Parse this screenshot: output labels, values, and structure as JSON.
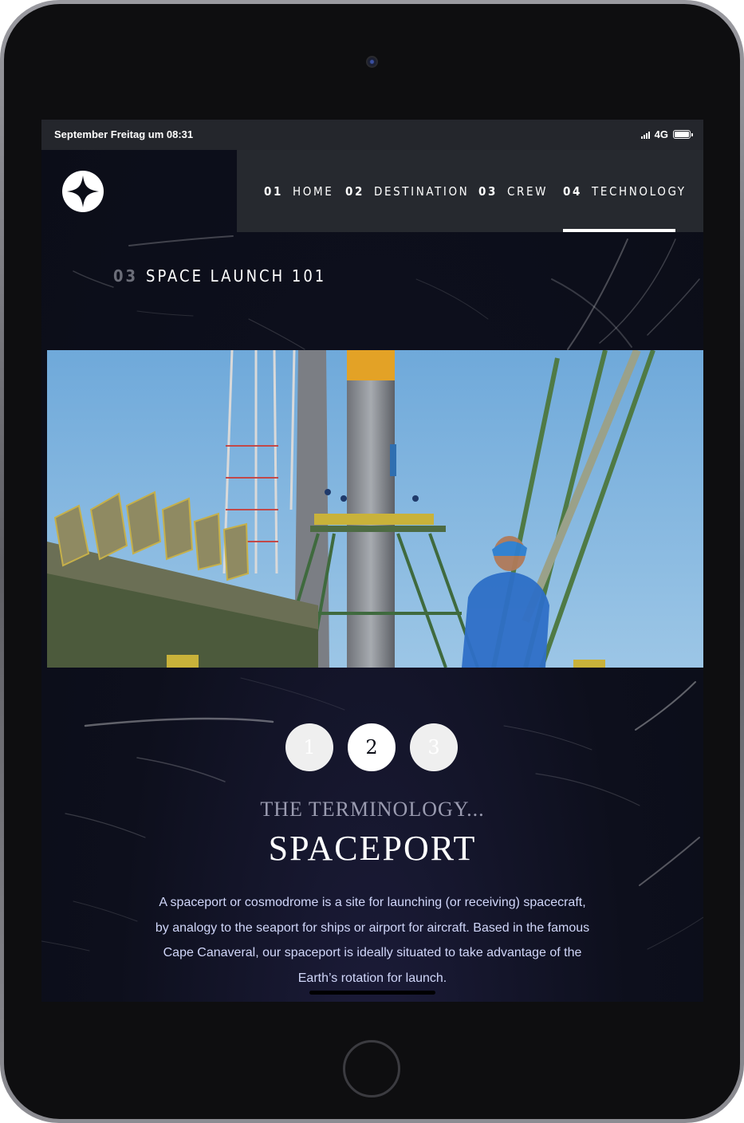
{
  "status_bar": {
    "time": "September Freitag um 08:31",
    "network": "4G"
  },
  "logo": {
    "icon": "four-point-star-icon"
  },
  "nav": {
    "items": [
      {
        "num": "01",
        "label": "HOME",
        "active": false
      },
      {
        "num": "02",
        "label": "DESTINATION",
        "active": false
      },
      {
        "num": "03",
        "label": "CREW",
        "active": false
      },
      {
        "num": "04",
        "label": "TECHNOLOGY",
        "active": true
      }
    ]
  },
  "page": {
    "num": "03",
    "title": "SPACE LAUNCH 101"
  },
  "photo": {
    "subject": "launch-vehicle-photo"
  },
  "steps": [
    {
      "label": "1",
      "active": false
    },
    {
      "label": "2",
      "active": true
    },
    {
      "label": "3",
      "active": false
    }
  ],
  "content": {
    "subheading": "THE TERMINOLOGY...",
    "heading": "SPACEPORT",
    "description": "A spaceport or cosmodrome is a site for launching (or receiving) spacecraft, by analogy to the seaport for ships or airport for aircraft. Based in the famous Cape Canaveral, our spaceport is ideally situated to take advantage of the Earth’s rotation for launch."
  },
  "colors": {
    "background": "#0b0d17",
    "nav_bg": "#26292f",
    "text_muted": "#d0d6f9",
    "active": "#ffffff"
  }
}
